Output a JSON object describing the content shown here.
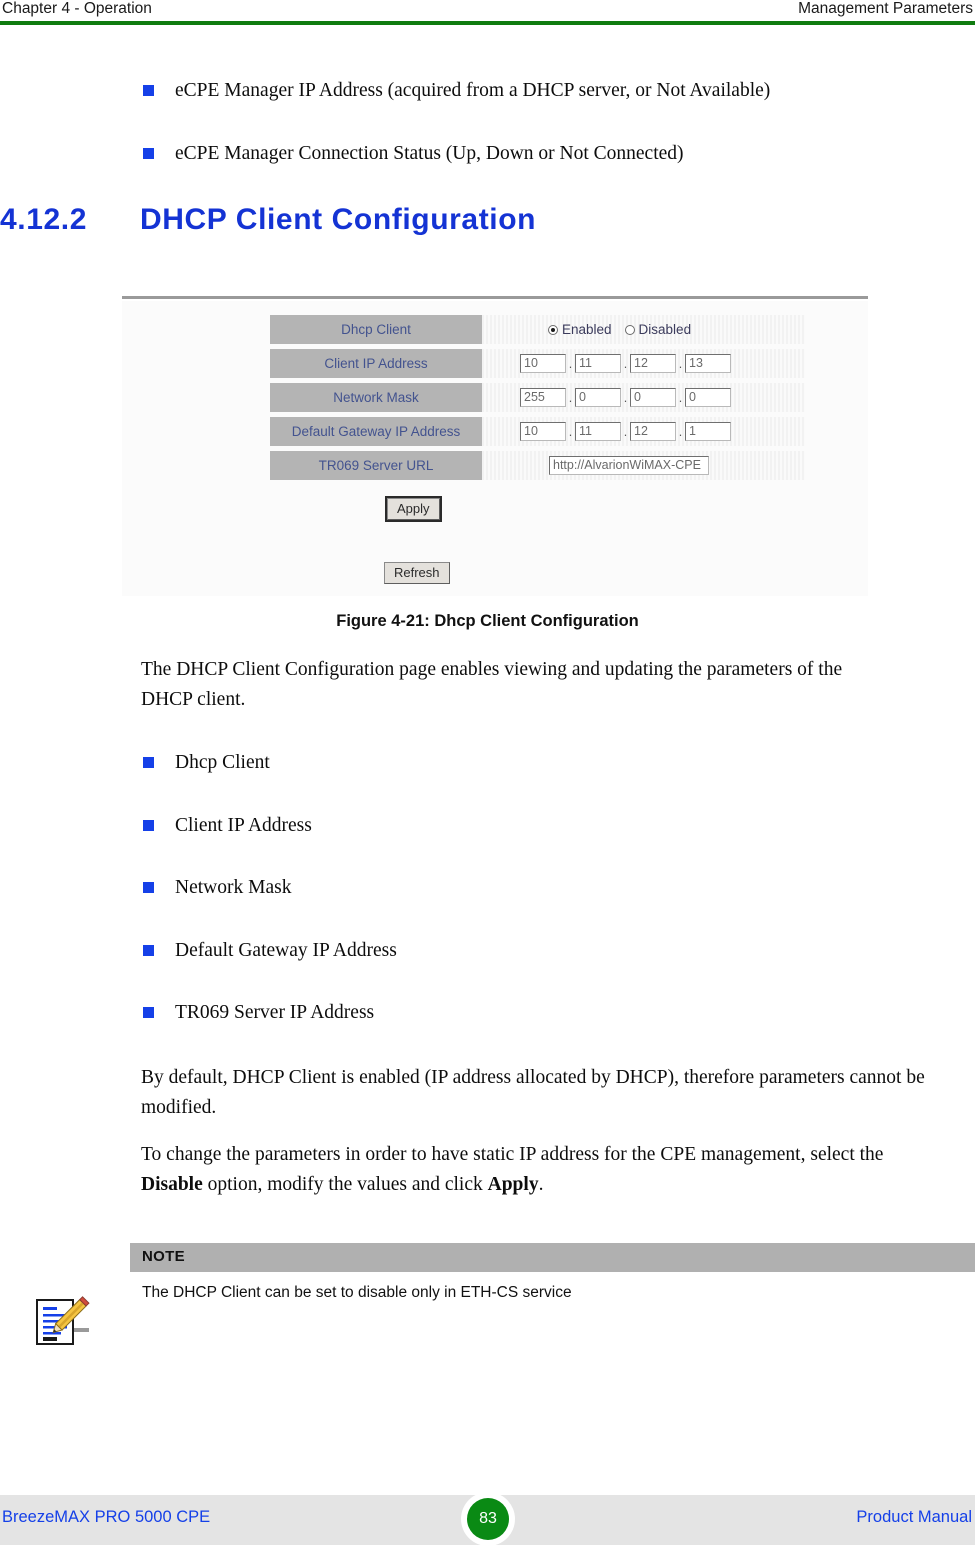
{
  "header": {
    "left": "Chapter 4 - Operation",
    "right": "Management Parameters",
    "rule_color": "#107c10"
  },
  "intro_bullets": [
    {
      "text": "eCPE Manager IP Address (acquired from a DHCP server, or Not Available)"
    },
    {
      "text": "eCPE Manager Connection Status (Up, Down or Not Connected)"
    }
  ],
  "section": {
    "number": "4.12.2",
    "title": "DHCP Client Configuration",
    "color": "#1433d4"
  },
  "figure": {
    "caption": "Figure 4-21: Dhcp Client Configuration",
    "form": {
      "rows": [
        {
          "label": "Dhcp Client",
          "type": "radio"
        },
        {
          "label": "Client IP Address",
          "type": "octets",
          "octets": [
            "10",
            "11",
            "12",
            "13"
          ]
        },
        {
          "label": "Network Mask",
          "type": "octets",
          "octets": [
            "255",
            "0",
            "0",
            "0"
          ]
        },
        {
          "label": "Default Gateway IP Address",
          "type": "octets",
          "octets": [
            "10",
            "11",
            "12",
            "1"
          ]
        },
        {
          "label": "TR069 Server URL",
          "type": "url",
          "value": "http://AlvarionWiMAX-CPE"
        }
      ],
      "radio_options": [
        {
          "label": "Enabled",
          "selected": true
        },
        {
          "label": "Disabled",
          "selected": false
        }
      ],
      "apply_label": "Apply",
      "refresh_label": "Refresh"
    }
  },
  "body": {
    "intro_paragraph": "The DHCP Client Configuration page enables viewing and updating the parameters of the DHCP client.",
    "parameter_bullets": [
      {
        "text": "Dhcp Client"
      },
      {
        "text": "Client IP Address"
      },
      {
        "text": "Network Mask"
      },
      {
        "text": "Default Gateway IP Address"
      },
      {
        "text": "TR069 Server IP Address"
      }
    ],
    "default_paragraph": "By default, DHCP Client is enabled (IP address allocated by DHCP), therefore parameters cannot be modified.",
    "change_paragraph": {
      "part1": "To change the parameters in order to have static IP address for the CPE management, select the ",
      "bold1": "Disable",
      "part2": " option, modify the values and click ",
      "bold2": "Apply",
      "part3": "."
    }
  },
  "note": {
    "title": "NOTE",
    "text": "The DHCP Client can be set to disable only in ETH-CS service"
  },
  "footer": {
    "left": "BreezeMAX PRO 5000 CPE",
    "page_number": "83",
    "right": "Product Manual",
    "page_badge_color": "#0a8a14"
  }
}
